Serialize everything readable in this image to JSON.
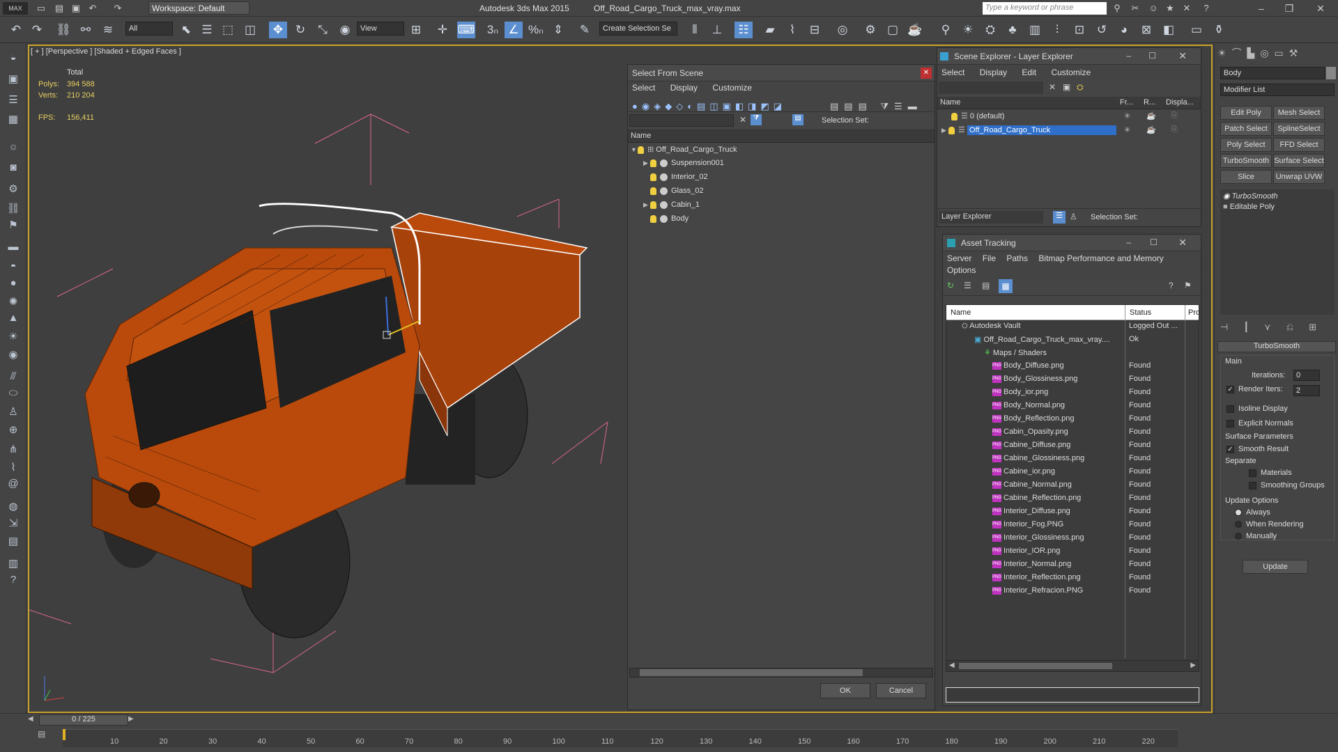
{
  "titlebar": {
    "app_title": "Autodesk 3ds Max 2015",
    "file_title": "Off_Road_Cargo_Truck_max_vray.max",
    "workspace": "Workspace: Default",
    "search_placeholder": "Type a keyword or phrase"
  },
  "toolbar": {
    "selection_filter": "All",
    "ref_coord": "View",
    "named_selection": "Create Selection Se"
  },
  "viewport": {
    "label": "[ + ] [Perspective ] [Shaded + Edged Faces ]",
    "stats_total": "Total",
    "polys_label": "Polys:",
    "polys_value": "394 588",
    "verts_label": "Verts:",
    "verts_value": "210 204",
    "fps_label": "FPS:",
    "fps_value": "156,411"
  },
  "select_from_scene": {
    "title": "Select From Scene",
    "menu": [
      "Select",
      "Display",
      "Customize"
    ],
    "selection_set_label": "Selection Set:",
    "col_name": "Name",
    "rows": [
      {
        "label": "Off_Road_Cargo_Truck",
        "indent": 0
      },
      {
        "label": "Suspension001",
        "indent": 1
      },
      {
        "label": "Interior_02",
        "indent": 1
      },
      {
        "label": "Glass_02",
        "indent": 1
      },
      {
        "label": "Cabin_1",
        "indent": 1
      },
      {
        "label": "Body",
        "indent": 1
      }
    ],
    "ok": "OK",
    "cancel": "Cancel"
  },
  "scene_explorer": {
    "title": "Scene Explorer - Layer Explorer",
    "menu": [
      "Select",
      "Display",
      "Edit",
      "Customize"
    ],
    "cols": [
      "Name",
      "Fr...",
      "R...",
      "Displa..."
    ],
    "rows": [
      "0 (default)",
      "Off_Road_Cargo_Truck"
    ],
    "footer_combo": "Layer Explorer",
    "selection_set_label": "Selection Set:"
  },
  "asset_tracking": {
    "title": "Asset Tracking",
    "menu": [
      "Server",
      "File",
      "Paths",
      "Bitmap Performance and Memory"
    ],
    "menu2": "Options",
    "cols": [
      "Name",
      "Status",
      "Pro"
    ],
    "rows": [
      {
        "name": "Autodesk Vault",
        "status": "Logged Out ..."
      },
      {
        "name": "Off_Road_Cargo_Truck_max_vray....",
        "status": "Ok"
      },
      {
        "name": "Maps / Shaders",
        "status": ""
      },
      {
        "name": "Body_Diffuse.png",
        "status": "Found"
      },
      {
        "name": "Body_Glossiness.png",
        "status": "Found"
      },
      {
        "name": "Body_ior.png",
        "status": "Found"
      },
      {
        "name": "Body_Normal.png",
        "status": "Found"
      },
      {
        "name": "Body_Reflection.png",
        "status": "Found"
      },
      {
        "name": "Cabin_Opasity.png",
        "status": "Found"
      },
      {
        "name": "Cabine_Diffuse.png",
        "status": "Found"
      },
      {
        "name": "Cabine_Glossiness.png",
        "status": "Found"
      },
      {
        "name": "Cabine_ior.png",
        "status": "Found"
      },
      {
        "name": "Cabine_Normal.png",
        "status": "Found"
      },
      {
        "name": "Cabine_Reflection.png",
        "status": "Found"
      },
      {
        "name": "Interior_Diffuse.png",
        "status": "Found"
      },
      {
        "name": "Interior_Fog.PNG",
        "status": "Found"
      },
      {
        "name": "Interior_Glossiness.png",
        "status": "Found"
      },
      {
        "name": "Interior_IOR.png",
        "status": "Found"
      },
      {
        "name": "Interior_Normal.png",
        "status": "Found"
      },
      {
        "name": "Interior_Reflection.png",
        "status": "Found"
      },
      {
        "name": "Interior_Refracion.PNG",
        "status": "Found"
      }
    ]
  },
  "command_panel": {
    "object_name": "Body",
    "modifier_list": "Modifier List",
    "buttons": [
      "Edit Poly",
      "Mesh Select",
      "Patch Select",
      "SplineSelect",
      "Poly Select",
      "FFD Select",
      "TurboSmooth",
      "Surface Select",
      "Slice",
      "Unwrap UVW"
    ],
    "stack": [
      "TurboSmooth",
      "Editable Poly"
    ],
    "rollout_title": "TurboSmooth",
    "main_label": "Main",
    "iterations_label": "Iterations:",
    "iterations_value": "0",
    "render_iters_label": "Render Iters:",
    "render_iters_value": "2",
    "isoline_label": "Isoline Display",
    "explicit_label": "Explicit Normals",
    "surface_params_label": "Surface Parameters",
    "smooth_result_label": "Smooth Result",
    "separate_label": "Separate",
    "materials_label": "Materials",
    "smoothing_groups_label": "Smoothing Groups",
    "update_options_label": "Update Options",
    "always_label": "Always",
    "when_rendering_label": "When Rendering",
    "manually_label": "Manually",
    "update_button": "Update"
  },
  "timeline": {
    "frame_counter": "0 / 225",
    "ticks": [
      "10",
      "20",
      "30",
      "40",
      "50",
      "60",
      "70",
      "80",
      "90",
      "100",
      "110",
      "120",
      "130",
      "140",
      "150",
      "160",
      "170",
      "180",
      "190",
      "200",
      "210",
      "220"
    ]
  },
  "colors": {
    "accent_blue": "#5b8fd0",
    "viewport_border": "#c9a227",
    "truck_orange": "#b94a0c"
  }
}
